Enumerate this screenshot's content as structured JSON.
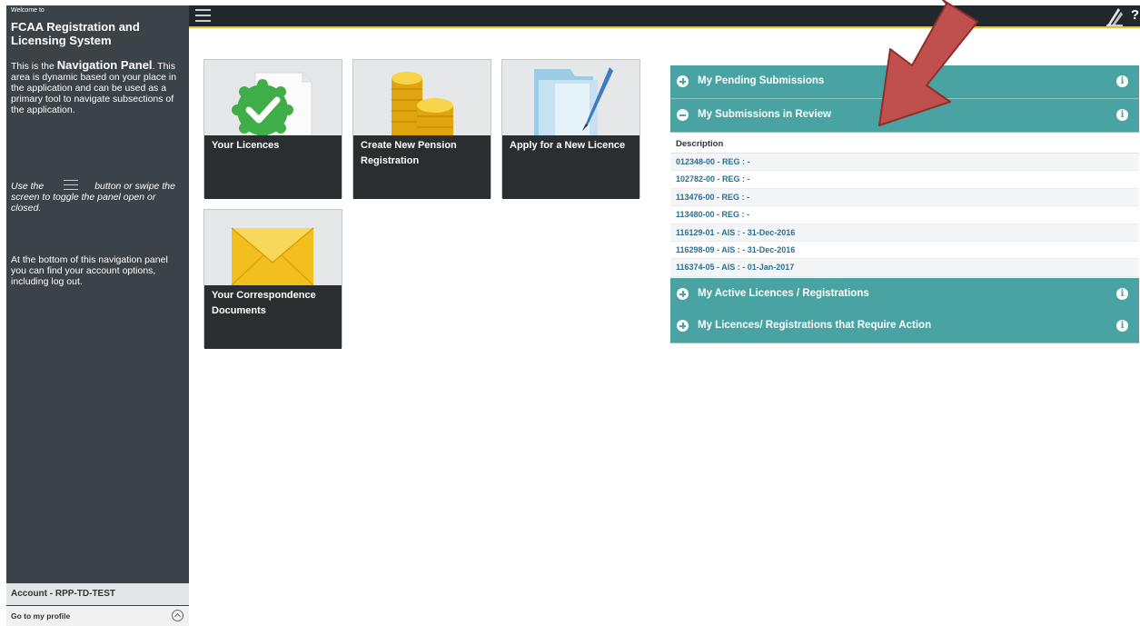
{
  "sidebar": {
    "welcome": "Welcome to",
    "app_title": "FCAA Registration and Licensing System",
    "intro_prefix": "This is the ",
    "intro_bold": "Navigation Panel",
    "intro_rest": ". This area is dynamic based on your place in the application and can be used as a primary tool to navigate subsections of the application.",
    "toggle_prefix": "Use the",
    "toggle_rest": "button or swipe the screen to toggle the panel open or closed.",
    "bottom_hint": "At the bottom of this navigation panel you can find your account options, including log out.",
    "account_label": "Account - RPP-TD-TEST",
    "profile_label": "Go to my profile"
  },
  "tiles": [
    {
      "label": "Your Licences",
      "icon": "licence-check-icon"
    },
    {
      "label": "Create New Pension Registration",
      "icon": "coins-icon"
    },
    {
      "label": "Apply for a New Licence",
      "icon": "folder-pen-icon"
    },
    {
      "label": "Your Correspondence Documents",
      "icon": "envelope-icon"
    }
  ],
  "panel": {
    "pending": "My Pending Submissions",
    "review": "My Submissions in Review",
    "active": "My Active Licences / Registrations",
    "action": "My Licences/ Registrations that Require Action",
    "table_header": "Description",
    "rows": [
      "012348-00 - REG : -",
      "102782-00 - REG : -",
      "113476-00 - REG : -",
      "113480-00 - REG : -",
      "116129-01 - AIS : - 31-Dec-2016",
      "116298-09 - AIS : - 31-Dec-2016",
      "116374-05 - AIS : - 01-Jan-2017"
    ]
  },
  "colors": {
    "sidebar": "#3b4248",
    "topbar": "#22272b",
    "accent_yellow": "#e6c22a",
    "teal": "#4aa3a3",
    "link": "#2a6f94",
    "arrow": "#c0504d"
  }
}
